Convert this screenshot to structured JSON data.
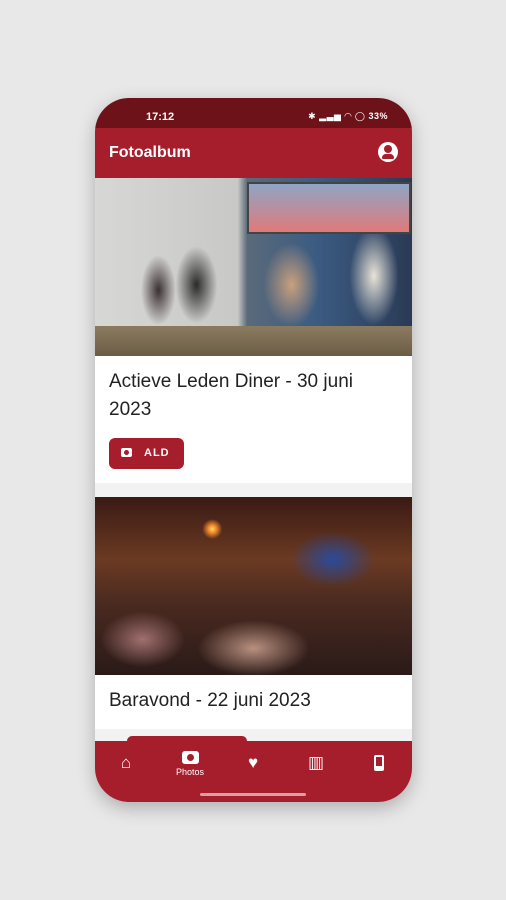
{
  "status": {
    "time": "17:12",
    "battery": "33%"
  },
  "app": {
    "title": "Fotoalbum"
  },
  "albums": [
    {
      "title": "Actieve Leden Diner - 30 juni 2023",
      "badge_label": "ALD"
    },
    {
      "title": "Baravond - 22 juni 2023"
    }
  ],
  "nav": {
    "items": [
      {
        "name": "home",
        "icon": "home-icon"
      },
      {
        "name": "photos",
        "label": "Photos",
        "icon": "camera-icon",
        "active": true
      },
      {
        "name": "favorites",
        "icon": "heart-icon"
      },
      {
        "name": "book",
        "icon": "book-icon"
      },
      {
        "name": "drink",
        "icon": "cup-icon"
      }
    ]
  },
  "colors": {
    "primary": "#a61d2b",
    "status_bar": "#6d1219"
  }
}
